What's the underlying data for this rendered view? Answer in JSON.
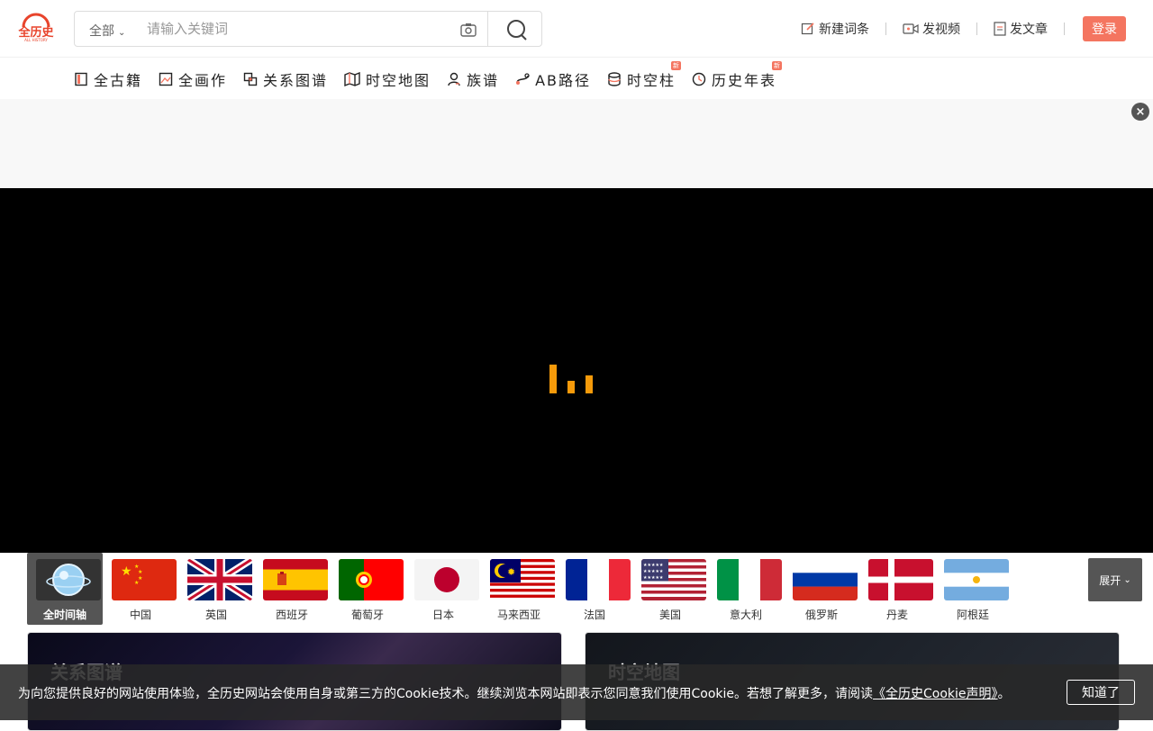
{
  "brand": {
    "logo_text": "全历史",
    "logo_subtext": "ALL HISTORY",
    "accent": "#f47560"
  },
  "search": {
    "scope": "全部",
    "placeholder": "请输入关键词",
    "camera_icon": "camera-icon",
    "search_icon": "search-icon"
  },
  "header_actions": [
    {
      "label": "新建词条",
      "icon": "edit-icon"
    },
    {
      "label": "发视频",
      "icon": "video-icon"
    },
    {
      "label": "发文章",
      "icon": "document-icon"
    }
  ],
  "login_label": "登录",
  "nav": [
    {
      "label": "全古籍",
      "icon": "book-icon",
      "badge": ""
    },
    {
      "label": "全画作",
      "icon": "painting-icon",
      "badge": ""
    },
    {
      "label": "关系图谱",
      "icon": "graph-icon",
      "badge": ""
    },
    {
      "label": "时空地图",
      "icon": "map-icon",
      "badge": ""
    },
    {
      "label": "族谱",
      "icon": "person-icon",
      "badge": ""
    },
    {
      "label": "AB路径",
      "icon": "path-icon",
      "badge": ""
    },
    {
      "label": "时空柱",
      "icon": "cylinder-icon",
      "badge": "新"
    },
    {
      "label": "历史年表",
      "icon": "clock-icon",
      "badge": "新"
    }
  ],
  "ad_close": "×",
  "loader_color": "#f59a0a",
  "flags": [
    {
      "label": "全时间轴",
      "icon": "globe-icon",
      "active": true
    },
    {
      "label": "中国",
      "icon": "flag-china-icon"
    },
    {
      "label": "英国",
      "icon": "flag-uk-icon"
    },
    {
      "label": "西班牙",
      "icon": "flag-spain-icon"
    },
    {
      "label": "葡萄牙",
      "icon": "flag-portugal-icon"
    },
    {
      "label": "日本",
      "icon": "flag-japan-icon"
    },
    {
      "label": "马来西亚",
      "icon": "flag-malaysia-icon"
    },
    {
      "label": "法国",
      "icon": "flag-france-icon"
    },
    {
      "label": "美国",
      "icon": "flag-usa-icon"
    },
    {
      "label": "意大利",
      "icon": "flag-italy-icon"
    },
    {
      "label": "俄罗斯",
      "icon": "flag-russia-icon"
    },
    {
      "label": "丹麦",
      "icon": "flag-denmark-icon"
    },
    {
      "label": "阿根廷",
      "icon": "flag-argentina-icon"
    }
  ],
  "expand_label": "展开",
  "cards": [
    {
      "title": "关系图谱",
      "subtitle": ""
    },
    {
      "title": "时空地图",
      "subtitle": ""
    }
  ],
  "cookie": {
    "text": "为向您提供良好的网站使用体验，全历史网站会使用自身或第三方的Cookie技术。继续浏览本网站即表示您同意我们使用Cookie。若想了解更多，请阅读",
    "link": "《全历史Cookie声明》",
    "end": "。",
    "button": "知道了"
  }
}
